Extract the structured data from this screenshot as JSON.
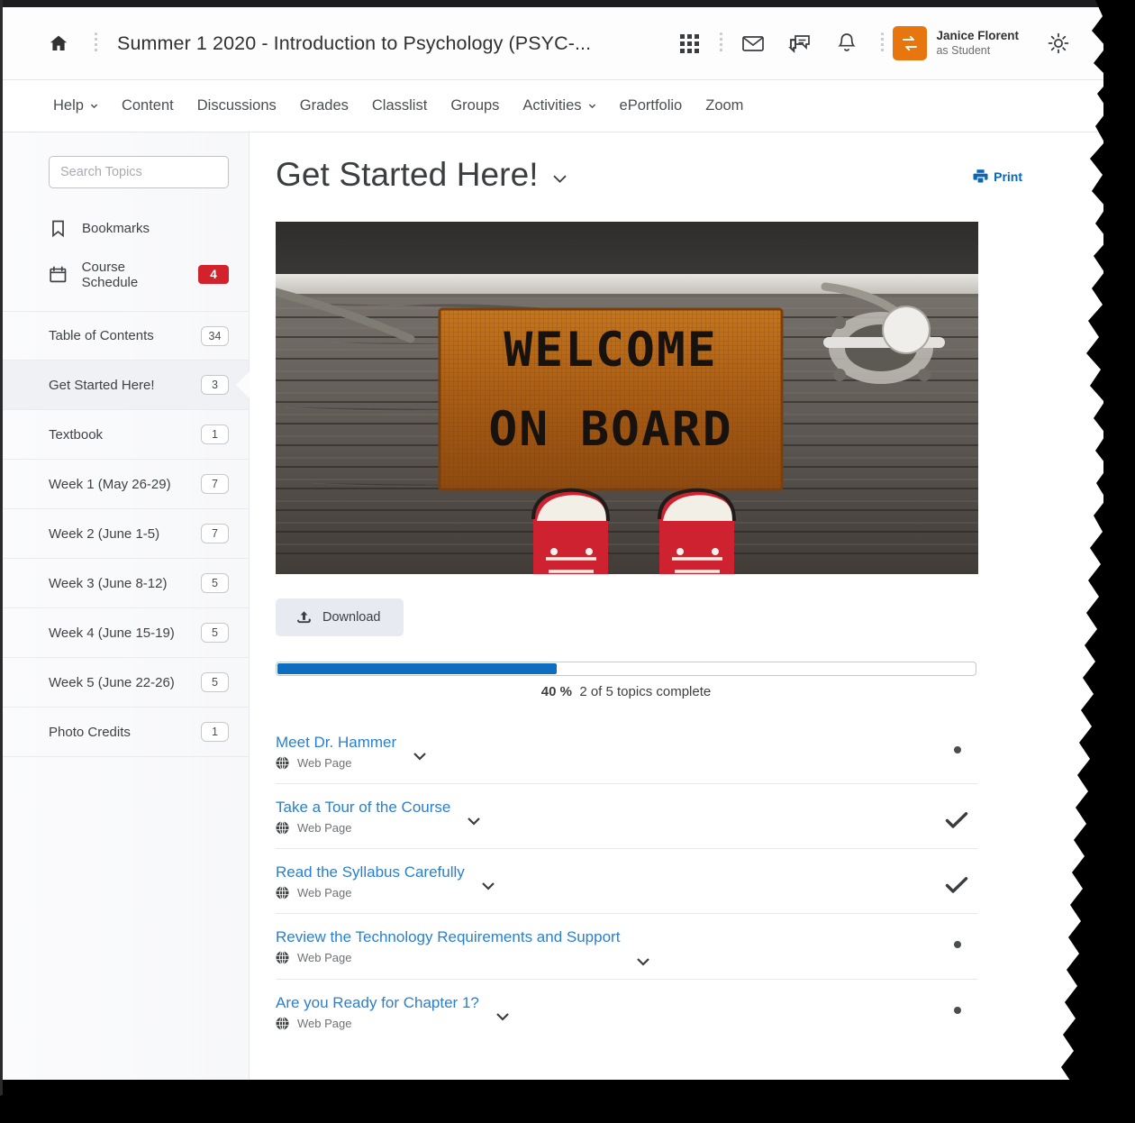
{
  "header": {
    "home_icon": "home-icon",
    "course_title": "Summer 1 2020 - Introduction to Psychology (PSYC-...",
    "icons": [
      "waffle-grid-icon",
      "envelope-icon",
      "chat-bubble-icon",
      "bell-icon"
    ],
    "user": {
      "avatar_icon": "role-switch-icon",
      "name": "Janice Florent",
      "role": "as Student",
      "avatar_color": "#e8760f"
    },
    "settings_icon": "gear-icon"
  },
  "navbar": {
    "items": [
      {
        "label": "Help",
        "has_caret": true
      },
      {
        "label": "Content",
        "has_caret": false
      },
      {
        "label": "Discussions",
        "has_caret": false
      },
      {
        "label": "Grades",
        "has_caret": false
      },
      {
        "label": "Classlist",
        "has_caret": false
      },
      {
        "label": "Groups",
        "has_caret": false
      },
      {
        "label": "Activities",
        "has_caret": true
      },
      {
        "label": "ePortfolio",
        "has_caret": false
      },
      {
        "label": "Zoom",
        "has_caret": false
      }
    ]
  },
  "sidebar": {
    "search": {
      "value": "",
      "placeholder": "Search Topics",
      "icon": "search-icon"
    },
    "links": [
      {
        "label": "Bookmarks",
        "icon": "bookmark-icon",
        "badge": null
      },
      {
        "label": "Course Schedule",
        "icon": "calendar-icon",
        "badge": "4"
      }
    ],
    "badge_color": "#d2222b",
    "toc": [
      {
        "label": "Table of Contents",
        "count": "34",
        "selected": false
      },
      {
        "label": "Get Started Here!",
        "count": "3",
        "selected": true
      },
      {
        "label": "Textbook",
        "count": "1",
        "selected": false
      },
      {
        "label": "Week 1 (May 26-29)",
        "count": "7",
        "selected": false
      },
      {
        "label": "Week 2 (June 1-5)",
        "count": "7",
        "selected": false
      },
      {
        "label": "Week 3 (June 8-12)",
        "count": "5",
        "selected": false
      },
      {
        "label": "Week 4 (June 15-19)",
        "count": "5",
        "selected": false
      },
      {
        "label": "Week 5 (June 22-26)",
        "count": "5",
        "selected": false
      },
      {
        "label": "Photo Credits",
        "count": "1",
        "selected": false
      }
    ]
  },
  "main": {
    "page_title": "Get Started Here!",
    "title_caret_icon": "chevron-down-icon",
    "print": {
      "label": "Print",
      "icon": "printer-icon",
      "color": "#0c66b3"
    },
    "hero": {
      "alt": "Brown coir doormat reading WELCOME ON BOARD on a weathered grey wooden dock, red sneakers at bottom, metal cleat with rope at right",
      "mat_text_line1": "WELCOME",
      "mat_text_line2": "ON BOARD"
    },
    "download": {
      "label": "Download",
      "icon": "download-cloud-icon"
    },
    "progress": {
      "percent": 40,
      "percent_label": "40 %",
      "status_label": "2 of 5 topics complete",
      "fill_color": "#0d6ec0"
    },
    "topics": [
      {
        "title": "Meet Dr. Hammer",
        "type": "Web Page",
        "type_icon": "globe-icon",
        "caret_icon": "chevron-down-icon",
        "status": "incomplete"
      },
      {
        "title": "Take a Tour of the Course",
        "type": "Web Page",
        "type_icon": "globe-icon",
        "caret_icon": "chevron-down-icon",
        "status": "complete"
      },
      {
        "title": "Read the Syllabus Carefully",
        "type": "Web Page",
        "type_icon": "globe-icon",
        "caret_icon": "chevron-down-icon",
        "status": "complete"
      },
      {
        "title": "Review the Technology Requirements and Support",
        "type": "Web Page",
        "type_icon": "globe-icon",
        "caret_icon": "chevron-down-icon",
        "status": "incomplete"
      },
      {
        "title": "Are you Ready for Chapter 1?",
        "type": "Web Page",
        "type_icon": "globe-icon",
        "caret_icon": "chevron-down-icon",
        "status": "incomplete"
      }
    ]
  }
}
